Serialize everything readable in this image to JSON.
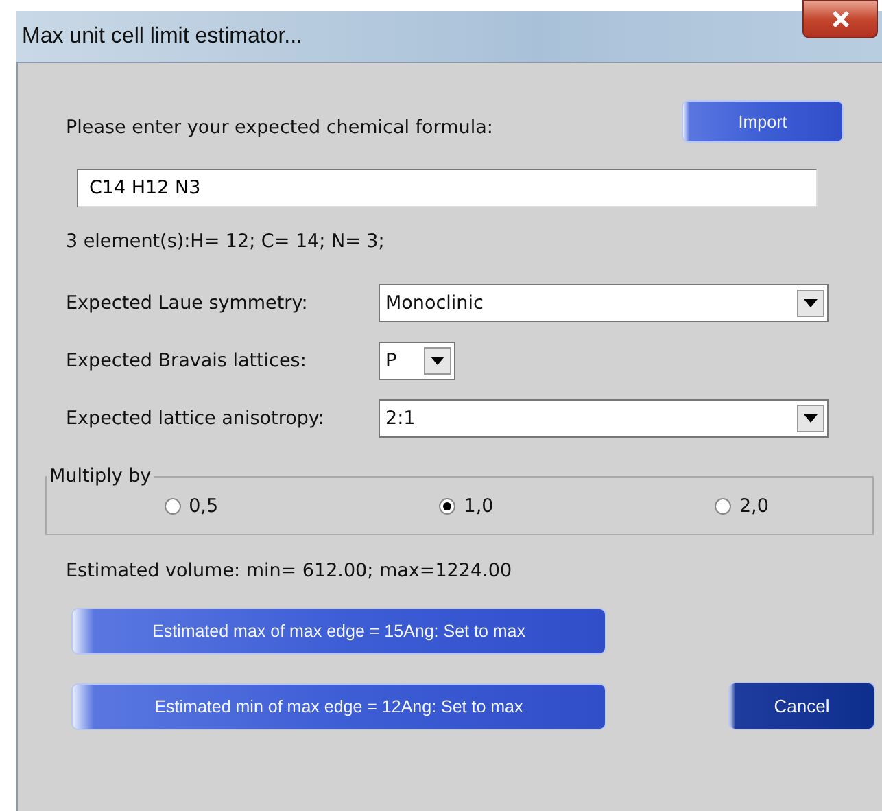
{
  "window": {
    "title": "Max unit cell limit estimator..."
  },
  "formula": {
    "label": "Please enter your expected chemical formula:",
    "value": "C14 H12 N3"
  },
  "import_button": "Import",
  "elements_summary": "3 element(s):H= 12; C= 14; N=  3;",
  "selects": [
    {
      "label": "Expected Laue symmetry:",
      "value": "Monoclinic",
      "kind": "wide"
    },
    {
      "label": "Expected Bravais lattices:",
      "value": "P",
      "kind": "narrow"
    },
    {
      "label": "Expected lattice anisotropy:",
      "value": "2:1",
      "kind": "wide"
    }
  ],
  "multiply": {
    "legend": "Multiply  by",
    "options": [
      {
        "label": "0,5",
        "selected": false
      },
      {
        "label": "1,0",
        "selected": true
      },
      {
        "label": "2,0",
        "selected": false
      }
    ]
  },
  "volume": "Estimated volume: min= 612.00; max=1224.00",
  "edge_buttons": [
    "Estimated max of max edge = 15Ang: Set to max",
    "Estimated min of max edge = 12Ang: Set to max"
  ],
  "cancel_button": "Cancel"
}
